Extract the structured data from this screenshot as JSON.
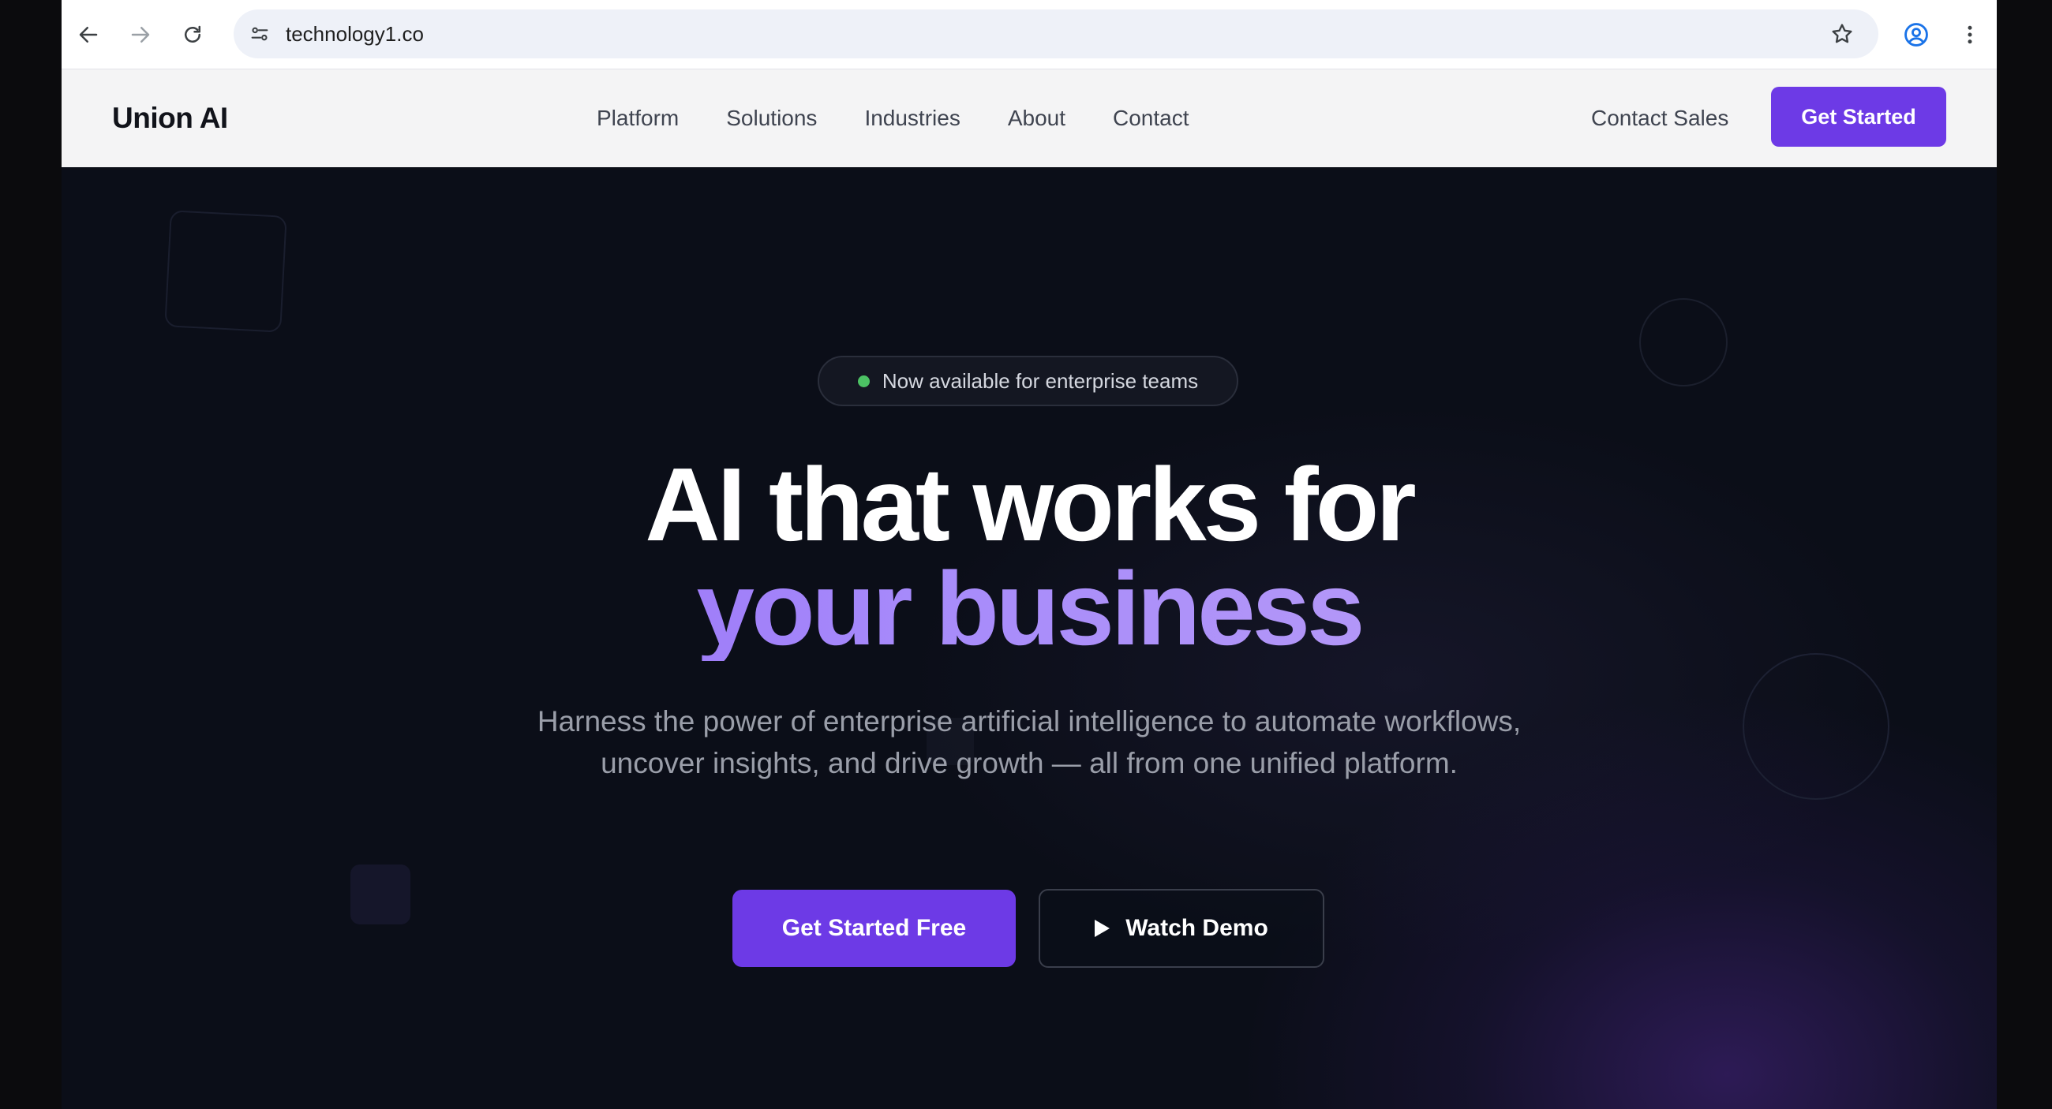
{
  "browser": {
    "url": "technology1.co",
    "icons": {
      "back": "arrow-left-icon",
      "forward": "arrow-right-icon",
      "reload": "reload-icon",
      "site_info": "site-settings-icon",
      "bookmark": "star-icon",
      "profile": "account-circle-icon",
      "menu": "kebab-menu-icon"
    }
  },
  "nav": {
    "logo": "Union AI",
    "links": [
      "Platform",
      "Solutions",
      "Industries",
      "About",
      "Contact"
    ],
    "contact_sales": "Contact Sales",
    "cta": "Get Started"
  },
  "hero": {
    "badge": "Now available for enterprise teams",
    "title_line1": "AI that works for",
    "title_line2": "your business",
    "subtitle": "Harness the power of enterprise artificial intelligence to automate workflows, uncover insights, and drive growth — all from one unified platform.",
    "primary_cta": "Get Started Free",
    "secondary_cta": "Watch Demo"
  },
  "colors": {
    "accent": "#6d3ae6",
    "accent_light": "#a78bfa",
    "hero_bg": "#0b0e18",
    "nav_bg": "#f4f4f5",
    "status_dot": "#4cc264"
  }
}
